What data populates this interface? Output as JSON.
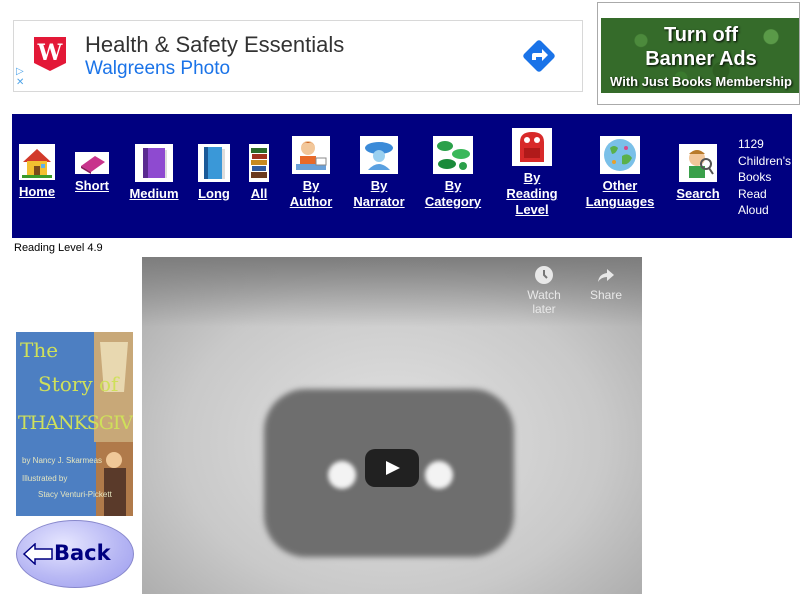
{
  "ad": {
    "title": "Health & Safety Essentials",
    "subtitle": "Walgreens Photo",
    "adchoices_top": "▷",
    "adchoices_bottom": "✕"
  },
  "banner": {
    "line1": "Turn off",
    "line2": "Banner Ads",
    "line3": "With Just Books Membership"
  },
  "nav": {
    "items": [
      {
        "label": "Home",
        "icon": "house-icon"
      },
      {
        "label": "Short",
        "icon": "pink-book-icon"
      },
      {
        "label": "Medium",
        "icon": "purple-book-icon"
      },
      {
        "label": "Long",
        "icon": "blue-book-icon"
      },
      {
        "label": "All",
        "icon": "book-stack-icon"
      },
      {
        "label1": "By",
        "label2": "Author",
        "icon": "author-icon"
      },
      {
        "label1": "By",
        "label2": "Narrator",
        "icon": "narrator-icon"
      },
      {
        "label1": "By",
        "label2": "Category",
        "icon": "category-icon"
      },
      {
        "label1": "By",
        "label2": "Reading",
        "label3": "Level",
        "icon": "backpack-icon"
      },
      {
        "label1": "Other",
        "label2": "Languages",
        "icon": "globe-icon"
      },
      {
        "label": "Search",
        "icon": "search-kid-icon"
      }
    ],
    "count": [
      "1129",
      "Children's",
      "Books",
      "Read",
      "Aloud"
    ]
  },
  "reading_level": "Reading Level 4.9",
  "cover": {
    "title1": "The",
    "title2": "Story of",
    "title3": "THANKSGIVING",
    "by": "by Nancy J. Skarmeas",
    "illustrated": "Illustrated by",
    "illustrator": "Stacy Venturi-Pickett"
  },
  "back_label": "Back",
  "video": {
    "watch_later": "Watch later",
    "share": "Share"
  }
}
